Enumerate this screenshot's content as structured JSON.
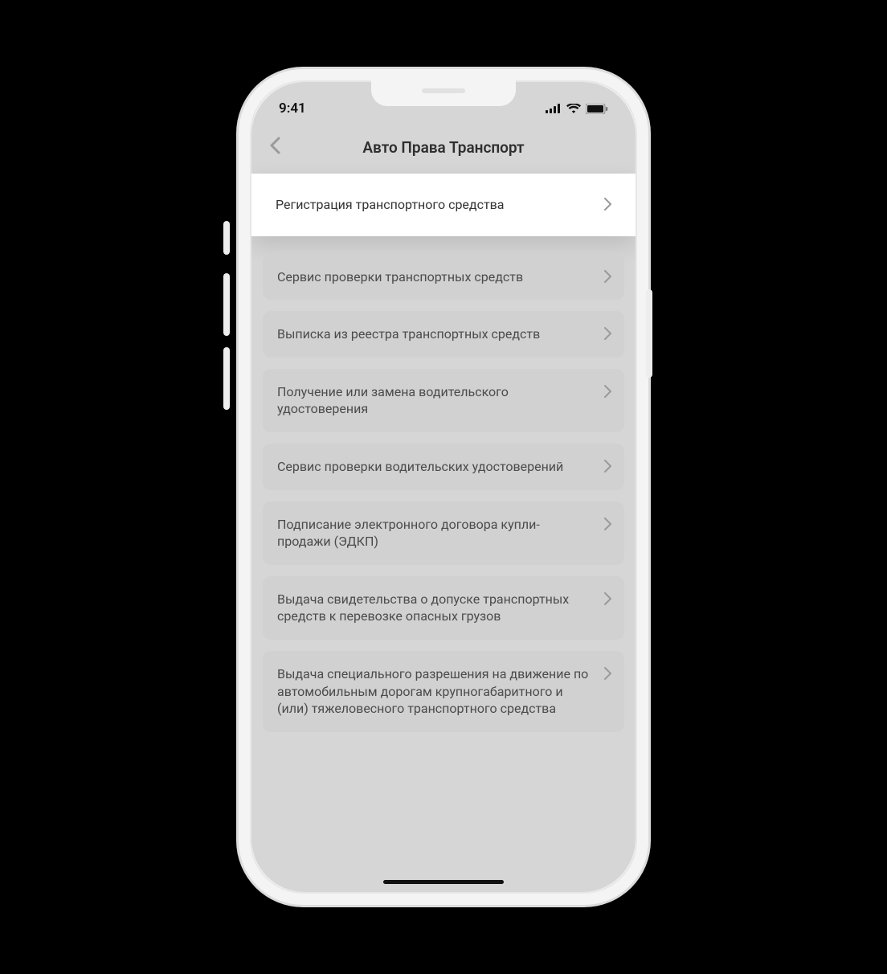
{
  "status": {
    "time": "9:41",
    "signal_icon": "signal-icon",
    "wifi_icon": "wifi-icon",
    "battery_icon": "battery-icon"
  },
  "header": {
    "title": "Авто Права Транспорт",
    "back_icon": "chevron-left-icon"
  },
  "list": {
    "items": [
      {
        "label": "Регистрация транспортного средства",
        "highlight": true
      },
      {
        "label": "Сервис проверки транспортных средств",
        "highlight": false
      },
      {
        "label": "Выписка из реестра транспортных средств",
        "highlight": false
      },
      {
        "label": "Получение или замена водительского удостоверения",
        "highlight": false
      },
      {
        "label": "Сервис проверки водительских удостоверений",
        "highlight": false
      },
      {
        "label": "Подписание электронного договора купли-продажи (ЭДКП)",
        "highlight": false
      },
      {
        "label": "Выдача свидетельства о допуске транспортных средств к перевозке опасных грузов",
        "highlight": false
      },
      {
        "label": "Выдача специального разрешения на движение по автомобильным дорогам крупногабаритного и (или) тяжеловесного транспортного средства",
        "highlight": false
      }
    ]
  }
}
